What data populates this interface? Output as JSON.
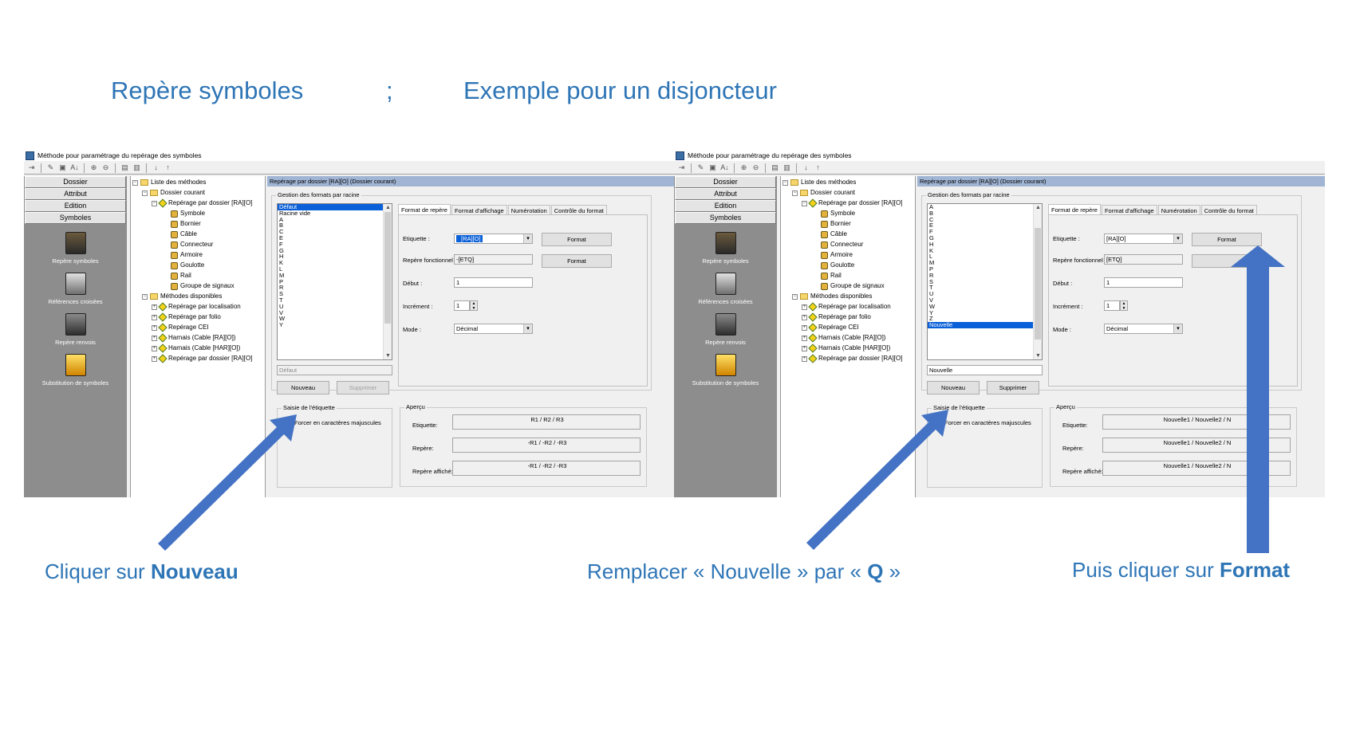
{
  "slide": {
    "heading_left": "Repère symboles",
    "heading_sep": ";",
    "heading_right": "Exemple pour un disjoncteur",
    "caption_left_prefix": "Cliquer sur ",
    "caption_left_bold": "Nouveau",
    "caption_mid_prefix": "Remplacer « Nouvelle » par « ",
    "caption_mid_bold": "Q",
    "caption_mid_suffix": " »",
    "caption_right_prefix": "Puis cliquer sur ",
    "caption_right_bold": "Format",
    "arrow_color": "#4472c4"
  },
  "dialog": {
    "title": "Méthode pour paramétrage du repérage des symboles",
    "sidebar_buttons": [
      "Dossier",
      "Attribut",
      "Edition",
      "Symboles"
    ],
    "sidebar_items": [
      {
        "label": "Repère symboles",
        "icon": "repere-symboles-icon"
      },
      {
        "label": "Références croisées",
        "icon": "references-croisees-icon"
      },
      {
        "label": "Repère renvois",
        "icon": "repere-renvois-icon"
      },
      {
        "label": "Substitution de symboles",
        "icon": "substitution-icon"
      }
    ],
    "tree": {
      "root": "Liste des méthodes",
      "dossier_courant": "Dossier courant",
      "method": "Repérage par dossier [RA][O]",
      "children": [
        "Symbole",
        "Bornier",
        "Câble",
        "Connecteur",
        "Armoire",
        "Goulotte",
        "Rail",
        "Groupe de signaux"
      ],
      "available": "Méthodes disponibles",
      "available_items": [
        "Repérage par localisation",
        "Repérage par folio",
        "Repérage CEI",
        "Harnais (Cable [RA][O])",
        "Harnais (Cable [HAR][O])",
        "Repérage par dossier [RA][O]"
      ]
    },
    "header": "Repérage par dossier [RA][O] (Dossier courant)",
    "group_formats": "Gestion des formats par racine",
    "tabs": [
      "Format de repère",
      "Format d'affichage",
      "Numérotation",
      "Contrôle du format"
    ],
    "labels": {
      "etiquette": "Etiquette :",
      "repere_fonctionnel": "Repère fonctionnel :",
      "debut": "Début :",
      "increment": "Incrément :",
      "mode": "Mode :",
      "saisie": "Saisie de l'étiquette",
      "forcer": "Forcer en caractères majuscules",
      "apercu": "Aperçu",
      "ap_etiquette": "Etiquette:",
      "ap_repere": "Repère:",
      "ap_repere_affiche": "Repère affiché:"
    },
    "values": {
      "etiquette": "[RA][O]",
      "repere_fonctionnel": "-[ETQ]",
      "debut": "1",
      "increment": "1",
      "mode": "Décimal",
      "format_btn": "Format",
      "nouveau_btn": "Nouveau",
      "supprimer_btn": "Supprimer"
    }
  },
  "left": {
    "list": [
      "Défaut",
      "Racine vide",
      "A",
      "B",
      "C",
      "E",
      "F",
      "G",
      "H",
      "K",
      "L",
      "M",
      "P",
      "R",
      "S",
      "T",
      "U",
      "V",
      "W",
      "Y"
    ],
    "selected": "Défaut",
    "name_field": "Défaut",
    "preview_etiquette": "R1 / R2 / R3",
    "preview_repere": "-R1 / -R2 / -R3",
    "preview_repere_affiche": "-R1 / -R2 / -R3"
  },
  "right": {
    "list": [
      "A",
      "B",
      "C",
      "E",
      "F",
      "G",
      "H",
      "K",
      "L",
      "M",
      "P",
      "R",
      "S",
      "T",
      "U",
      "V",
      "W",
      "Y",
      "Z",
      "Nouvelle"
    ],
    "selected": "Nouvelle",
    "name_field": "Nouvelle",
    "etiquette": "[RA][O]",
    "repere_fonctionnel": "[ETQ]",
    "preview_etiquette": "Nouvelle1 / Nouvelle2 / N",
    "preview_repere": "Nouvelle1 / Nouvelle2 / N",
    "preview_repere_affiche": "Nouvelle1 / Nouvelle2 / N"
  }
}
